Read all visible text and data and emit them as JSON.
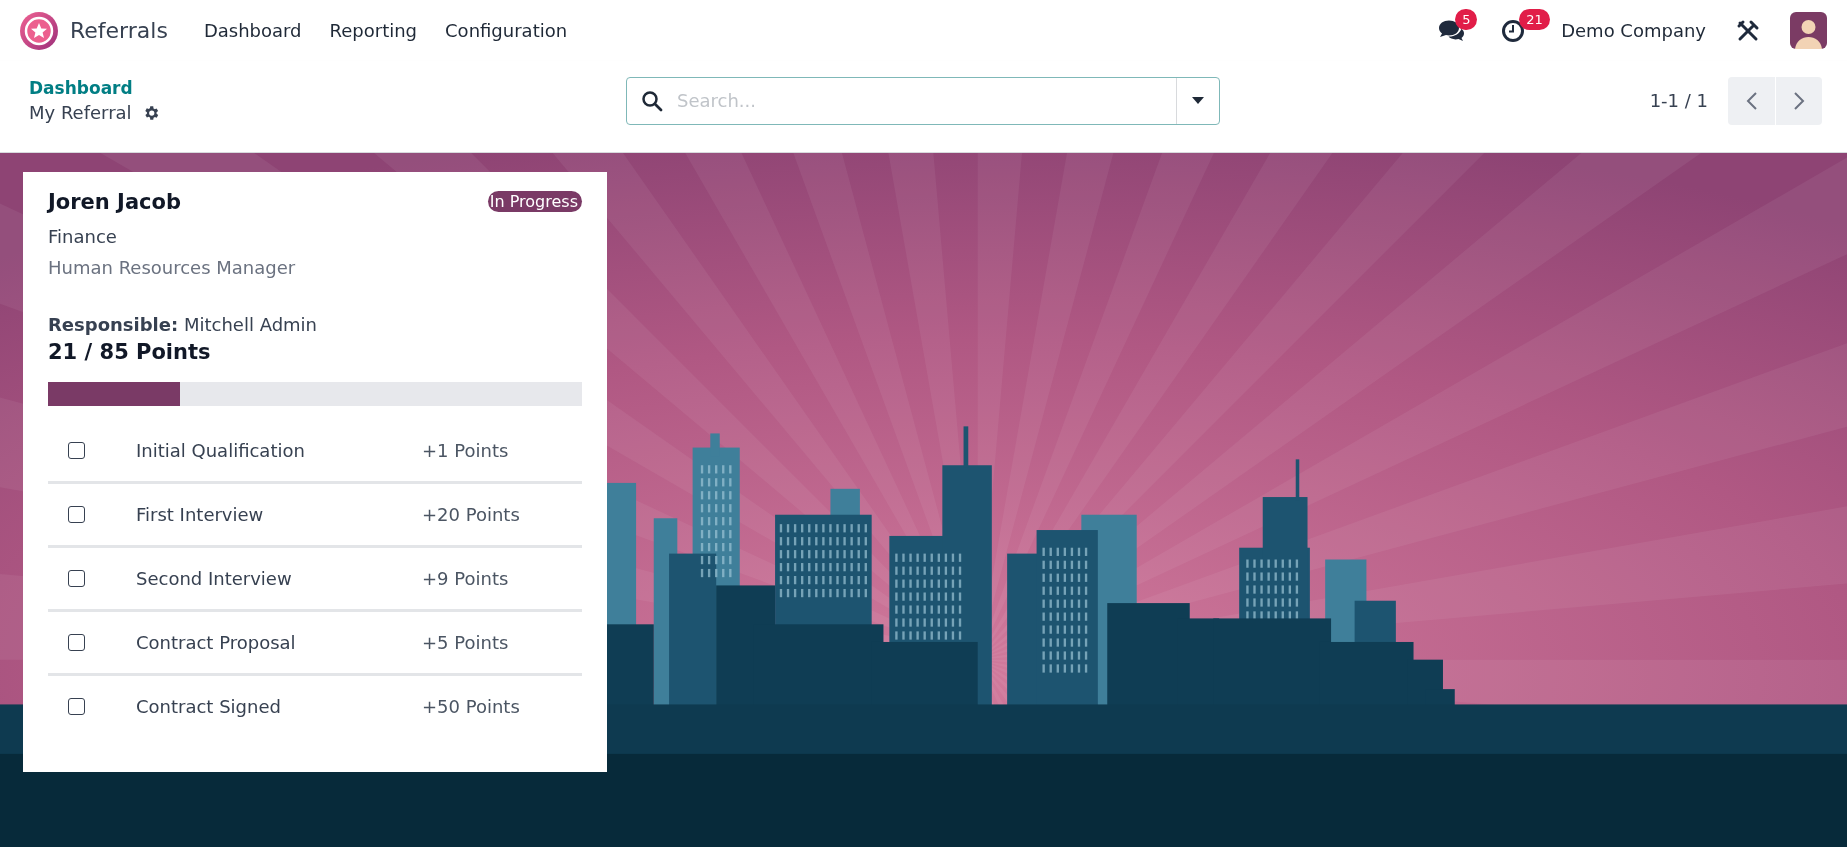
{
  "app": {
    "name": "Referrals"
  },
  "menu": [
    {
      "label": "Dashboard"
    },
    {
      "label": "Reporting"
    },
    {
      "label": "Configuration"
    }
  ],
  "systray": {
    "messages_count": "5",
    "activities_count": "21",
    "company": "Demo Company"
  },
  "breadcrumb": {
    "parent": "Dashboard",
    "current": "My Referral"
  },
  "search": {
    "placeholder": "Search..."
  },
  "pager": {
    "value": "1-1 / 1"
  },
  "referral": {
    "name": "Joren Jacob",
    "status": "In Progress",
    "department": "Finance",
    "job": "Human Resources Manager",
    "responsible_label": "Responsible:",
    "responsible": "Mitchell Admin",
    "points": "21 / 85 Points",
    "level": 0.247,
    "stages": [
      {
        "name": "Initial Qualification",
        "points": "+1 Points",
        "checked": false
      },
      {
        "name": "First Interview",
        "points": "+20 Points",
        "checked": false
      },
      {
        "name": "Second Interview",
        "points": "+9 Points",
        "checked": false
      },
      {
        "name": "Contract Proposal",
        "points": "+5 Points",
        "checked": false
      },
      {
        "name": "Contract Signed",
        "points": "+50 Points",
        "checked": false
      }
    ]
  }
}
